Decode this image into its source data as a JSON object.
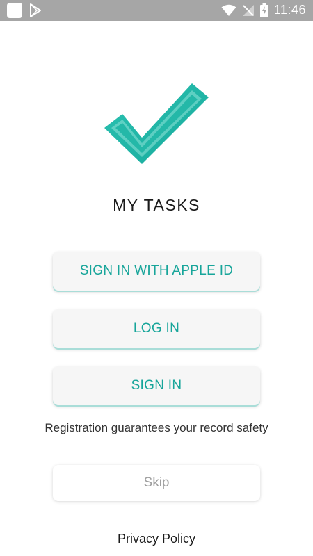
{
  "status_bar": {
    "time": "11:46",
    "icons": [
      "app-icon",
      "play-store-icon",
      "wifi-icon",
      "no-signal-icon",
      "battery-charging-icon"
    ]
  },
  "app": {
    "title": "MY TASKS",
    "logo_icon": "checkmark-icon",
    "accent_color": "#17a59a"
  },
  "buttons": {
    "apple": "SIGN IN WITH APPLE ID",
    "login": "LOG IN",
    "signin": "SIGN IN",
    "skip": "Skip"
  },
  "registration_note": "Registration guarantees your record safety",
  "privacy_link": "Privacy Policy"
}
